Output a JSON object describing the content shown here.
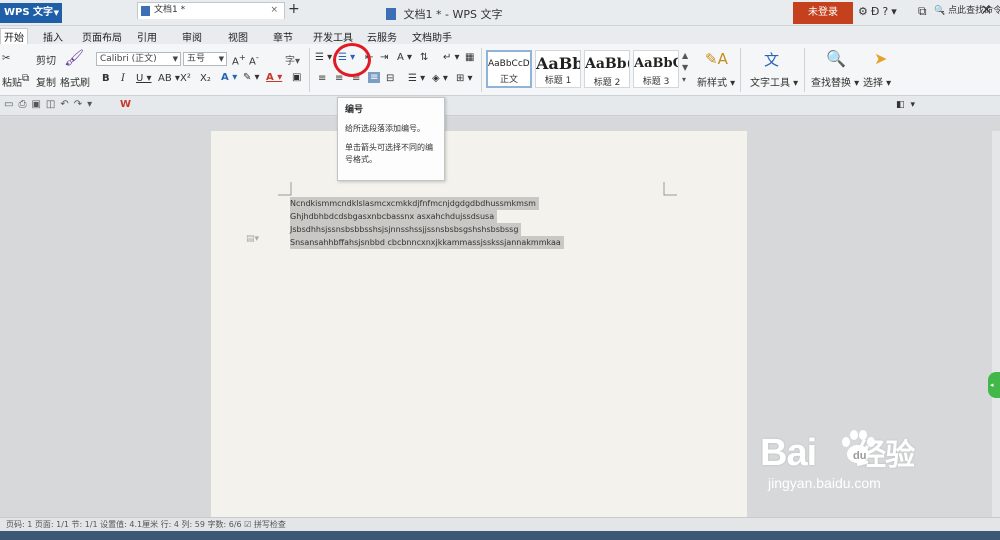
{
  "titlebar": {
    "app_name": "WPS 文字",
    "document_title": "文档1 * - WPS 文字",
    "login_label": "未登录",
    "help_label": "?"
  },
  "menu": {
    "tabs": [
      "开始",
      "插入",
      "页面布局",
      "引用",
      "审阅",
      "视图",
      "章节",
      "开发工具",
      "云服务",
      "文档助手"
    ]
  },
  "ribbon": {
    "cut_label": "剪切",
    "copy_label": "复制",
    "format_painter_label": "格式刷",
    "paste_label": "粘贴",
    "font_name": "Calibri (正文)",
    "font_size": "五号",
    "styles": [
      {
        "sample": "AaBbCcDd",
        "label": "正文"
      },
      {
        "sample": "AaBb",
        "label": "标题 1"
      },
      {
        "sample": "AaBb(",
        "label": "标题 2"
      },
      {
        "sample": "AaBbC",
        "label": "标题 3"
      }
    ],
    "new_style_label": "新样式",
    "text_tools_label": "文字工具",
    "find_replace_label": "查找替换",
    "select_label": "选择"
  },
  "tabbar": {
    "doc_tab_label": "文档1 *",
    "search_placeholder": "点此查找命令"
  },
  "tooltip": {
    "title": "编号",
    "description": "给所选段落添加编号。",
    "hint": "单击箭头可选择不同的编号格式。"
  },
  "document": {
    "lines": [
      "Ncndkismmcndklslasmcxcmkkdjfnfmcnjdgdgdbdhussmkmsm",
      "Ghjhdbhbdcdsbgasxnbcbassnx asxahchdujssdsusa",
      "Jsbsdhhsjssnsbsbbsshsjsjnnsshssjjssnsbsbsgshshsbsbssg",
      "Snsansahhbffahsjsnbbd cbcbnncxnxjkkammassjsskssjannakmmkaa"
    ]
  },
  "statusbar": {
    "text": "页码: 1   页面: 1/1   节: 1/1   设置值: 4.1厘米   行: 4   列: 59   字数: 6/6   ☑ 拼写检查"
  },
  "watermark": {
    "brand": "Bai",
    "brand_suffix": "经验",
    "url": "jingyan.baidu.com"
  },
  "colors": {
    "accent": "#1f5fa8",
    "login_bg": "#c5411e",
    "highlight_circle": "#e01b24",
    "selection": "#c9c8c4"
  }
}
